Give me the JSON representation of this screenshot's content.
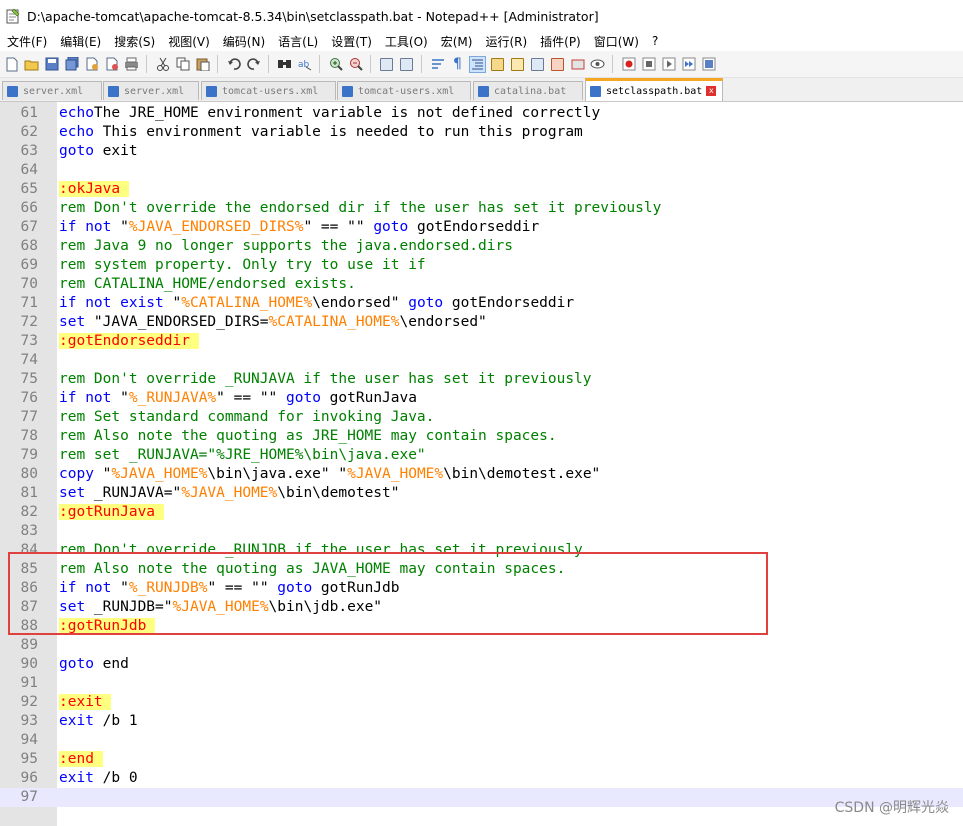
{
  "window": {
    "title": "D:\\apache-tomcat\\apache-tomcat-8.5.34\\bin\\setclasspath.bat - Notepad++ [Administrator]"
  },
  "menu": [
    {
      "id": "file",
      "label": "文件(F)"
    },
    {
      "id": "edit",
      "label": "编辑(E)"
    },
    {
      "id": "search",
      "label": "搜索(S)"
    },
    {
      "id": "view",
      "label": "视图(V)"
    },
    {
      "id": "encoding",
      "label": "编码(N)"
    },
    {
      "id": "language",
      "label": "语言(L)"
    },
    {
      "id": "settings",
      "label": "设置(T)"
    },
    {
      "id": "tools",
      "label": "工具(O)"
    },
    {
      "id": "macro",
      "label": "宏(M)"
    },
    {
      "id": "run",
      "label": "运行(R)"
    },
    {
      "id": "plugins",
      "label": "插件(P)"
    },
    {
      "id": "window",
      "label": "窗口(W)"
    },
    {
      "id": "help",
      "label": "?"
    }
  ],
  "tabs": [
    {
      "label": "server.xml",
      "active": false
    },
    {
      "label": "server.xml",
      "active": false
    },
    {
      "label": "tomcat-users.xml",
      "active": false
    },
    {
      "label": "tomcat-users.xml",
      "active": false
    },
    {
      "label": "catalina.bat",
      "active": false
    },
    {
      "label": "setclasspath.bat",
      "active": true
    }
  ],
  "tab_close_glyph": "x",
  "colors": {
    "keyword": "#0000ff",
    "comment": "#008000",
    "variable": "#ff8000",
    "label_text": "#ff0000",
    "label_bg": "#ffff80",
    "highlight_box": "#e0403e",
    "active_tab_accent": "#f5a623"
  },
  "editor": {
    "current_line": 97,
    "lines": [
      {
        "n": "61",
        "t": [
          [
            "kw",
            "echo"
          ],
          [
            "",
            "The JRE_HOME environment variable is not defined correctly"
          ]
        ]
      },
      {
        "n": "62",
        "t": [
          [
            "kw",
            "echo"
          ],
          [
            "",
            " This environment variable is needed to run this program"
          ]
        ]
      },
      {
        "n": "63",
        "t": [
          [
            "kw",
            "goto"
          ],
          [
            "",
            " exit"
          ]
        ]
      },
      {
        "n": "64",
        "t": []
      },
      {
        "n": "65",
        "t": [
          [
            "lbl",
            ":okJava "
          ]
        ]
      },
      {
        "n": "66",
        "t": [
          [
            "cm",
            "rem Don't override the endorsed dir if the user has set it previously"
          ]
        ]
      },
      {
        "n": "67",
        "t": [
          [
            "kw",
            "if not"
          ],
          [
            "",
            " \""
          ],
          [
            "var",
            "%JAVA_ENDORSED_DIRS%"
          ],
          [
            "",
            "\" == \"\" "
          ],
          [
            "kw",
            "goto"
          ],
          [
            "",
            " gotEndorseddir"
          ]
        ]
      },
      {
        "n": "68",
        "t": [
          [
            "cm",
            "rem Java 9 no longer supports the java.endorsed.dirs"
          ]
        ]
      },
      {
        "n": "69",
        "t": [
          [
            "cm",
            "rem system property. Only try to use it if"
          ]
        ]
      },
      {
        "n": "70",
        "t": [
          [
            "cm",
            "rem CATALINA_HOME/endorsed exists."
          ]
        ]
      },
      {
        "n": "71",
        "t": [
          [
            "kw",
            "if not exist"
          ],
          [
            "",
            " \""
          ],
          [
            "var",
            "%CATALINA_HOME%"
          ],
          [
            "",
            "\\endorsed\" "
          ],
          [
            "kw",
            "goto"
          ],
          [
            "",
            " gotEndorseddir"
          ]
        ]
      },
      {
        "n": "72",
        "t": [
          [
            "kw",
            "set"
          ],
          [
            "",
            " \"JAVA_ENDORSED_DIRS="
          ],
          [
            "var",
            "%CATALINA_HOME%"
          ],
          [
            "",
            "\\endorsed\""
          ]
        ]
      },
      {
        "n": "73",
        "t": [
          [
            "lbl",
            ":gotEndorseddir "
          ]
        ]
      },
      {
        "n": "74",
        "t": []
      },
      {
        "n": "75",
        "t": [
          [
            "cm",
            "rem Don't override _RUNJAVA if the user has set it previously"
          ]
        ]
      },
      {
        "n": "76",
        "t": [
          [
            "kw",
            "if not"
          ],
          [
            "",
            " \""
          ],
          [
            "var",
            "%_RUNJAVA%"
          ],
          [
            "",
            "\" == \"\" "
          ],
          [
            "kw",
            "goto"
          ],
          [
            "",
            " gotRunJava"
          ]
        ]
      },
      {
        "n": "77",
        "t": [
          [
            "cm",
            "rem Set standard command for invoking Java."
          ]
        ]
      },
      {
        "n": "78",
        "t": [
          [
            "cm",
            "rem Also note the quoting as JRE_HOME may contain spaces."
          ]
        ]
      },
      {
        "n": "79",
        "t": [
          [
            "cm",
            "rem set _RUNJAVA=\"%JRE_HOME%\\bin\\java.exe\""
          ]
        ]
      },
      {
        "n": "80",
        "t": [
          [
            "kw",
            "copy"
          ],
          [
            "",
            " \""
          ],
          [
            "var",
            "%JAVA_HOME%"
          ],
          [
            "",
            "\\bin\\java.exe\" \""
          ],
          [
            "var",
            "%JAVA_HOME%"
          ],
          [
            "",
            "\\bin\\demotest.exe\""
          ]
        ]
      },
      {
        "n": "81",
        "t": [
          [
            "kw",
            "set"
          ],
          [
            "",
            " _RUNJAVA=\""
          ],
          [
            "var",
            "%JAVA_HOME%"
          ],
          [
            "",
            "\\bin\\demotest\""
          ]
        ]
      },
      {
        "n": "82",
        "t": [
          [
            "lbl",
            ":gotRunJava "
          ]
        ]
      },
      {
        "n": "83",
        "t": []
      },
      {
        "n": "84",
        "t": [
          [
            "cm",
            "rem Don't override _RUNJDB if the user has set it previously"
          ]
        ]
      },
      {
        "n": "85",
        "t": [
          [
            "cm",
            "rem Also note the quoting as JAVA_HOME may contain spaces."
          ]
        ]
      },
      {
        "n": "86",
        "t": [
          [
            "kw",
            "if not"
          ],
          [
            "",
            " \""
          ],
          [
            "var",
            "%_RUNJDB%"
          ],
          [
            "",
            "\" == \"\" "
          ],
          [
            "kw",
            "goto"
          ],
          [
            "",
            " gotRunJdb"
          ]
        ]
      },
      {
        "n": "87",
        "t": [
          [
            "kw",
            "set"
          ],
          [
            "",
            " _RUNJDB=\""
          ],
          [
            "var",
            "%JAVA_HOME%"
          ],
          [
            "",
            "\\bin\\jdb.exe\""
          ]
        ]
      },
      {
        "n": "88",
        "t": [
          [
            "lbl",
            ":gotRunJdb "
          ]
        ]
      },
      {
        "n": "89",
        "t": []
      },
      {
        "n": "90",
        "t": [
          [
            "kw",
            "goto"
          ],
          [
            "",
            " end"
          ]
        ]
      },
      {
        "n": "91",
        "t": []
      },
      {
        "n": "92",
        "t": [
          [
            "lbl",
            ":exit "
          ]
        ]
      },
      {
        "n": "93",
        "t": [
          [
            "kw",
            "exit"
          ],
          [
            "",
            " /b 1"
          ]
        ]
      },
      {
        "n": "94",
        "t": []
      },
      {
        "n": "95",
        "t": [
          [
            "lbl",
            ":end "
          ]
        ]
      },
      {
        "n": "96",
        "t": [
          [
            "kw",
            "exit"
          ],
          [
            "",
            " /b 0"
          ]
        ]
      },
      {
        "n": "97",
        "t": []
      }
    ]
  },
  "watermark": "CSDN @明辉光焱"
}
